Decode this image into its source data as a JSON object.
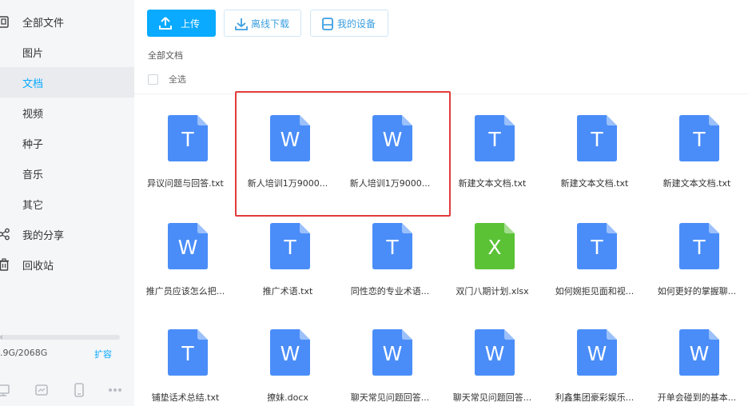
{
  "sidebar": {
    "items": [
      {
        "label": "全部文件",
        "icon": "folder-icon",
        "active": false
      },
      {
        "label": "图片",
        "icon": "",
        "active": false
      },
      {
        "label": "文档",
        "icon": "",
        "active": true
      },
      {
        "label": "视频",
        "icon": "",
        "active": false
      },
      {
        "label": "种子",
        "icon": "",
        "active": false
      },
      {
        "label": "音乐",
        "icon": "",
        "active": false
      },
      {
        "label": "其它",
        "icon": "",
        "active": false
      },
      {
        "label": "我的分享",
        "icon": "share-icon",
        "active": false
      },
      {
        "label": "回收站",
        "icon": "trash-icon",
        "active": false
      }
    ],
    "storage_text": ".9G/2068G",
    "storage_used": 0.02,
    "expand_label": "扩容"
  },
  "toolbar": {
    "upload_label": "上传",
    "offline_download_label": "离线下载",
    "my_devices_label": "我的设备"
  },
  "breadcrumb": "全部文档",
  "select_all_label": "全选",
  "files": [
    {
      "name": "异议问题与回答.txt",
      "type": "T",
      "color": "#4a8df8"
    },
    {
      "name": "新人培训1万9000...",
      "type": "W",
      "color": "#4a8df8"
    },
    {
      "name": "新人培训1万9000...",
      "type": "W",
      "color": "#4a8df8"
    },
    {
      "name": "新建文本文档.txt",
      "type": "T",
      "color": "#4a8df8"
    },
    {
      "name": "新建文本文档.txt",
      "type": "T",
      "color": "#4a8df8"
    },
    {
      "name": "新建文本文档.txt",
      "type": "T",
      "color": "#4a8df8"
    },
    {
      "name": "推广员应该怎么把...",
      "type": "W",
      "color": "#4a8df8"
    },
    {
      "name": "推广术语.txt",
      "type": "T",
      "color": "#4a8df8"
    },
    {
      "name": "同性恋的专业术语...",
      "type": "T",
      "color": "#4a8df8"
    },
    {
      "name": "双门八期计划.xlsx",
      "type": "X",
      "color": "#5bc236"
    },
    {
      "name": "如何婉拒见面和视...",
      "type": "T",
      "color": "#4a8df8"
    },
    {
      "name": "如何更好的掌握聊...",
      "type": "T",
      "color": "#4a8df8"
    },
    {
      "name": "铺垫话术总结.txt",
      "type": "T",
      "color": "#4a8df8"
    },
    {
      "name": "撩妹.docx",
      "type": "W",
      "color": "#4a8df8"
    },
    {
      "name": "聊天常见问题回答...",
      "type": "W",
      "color": "#4a8df8"
    },
    {
      "name": "聊天常见问题回答...",
      "type": "W",
      "color": "#4a8df8"
    },
    {
      "name": "利鑫集团豪彩娱乐...",
      "type": "W",
      "color": "#4a8df8"
    },
    {
      "name": "开单会碰到的基本...",
      "type": "W",
      "color": "#4a8df8"
    }
  ],
  "colors": {
    "accent": "#09aaff",
    "highlight": "#e33b3b"
  }
}
